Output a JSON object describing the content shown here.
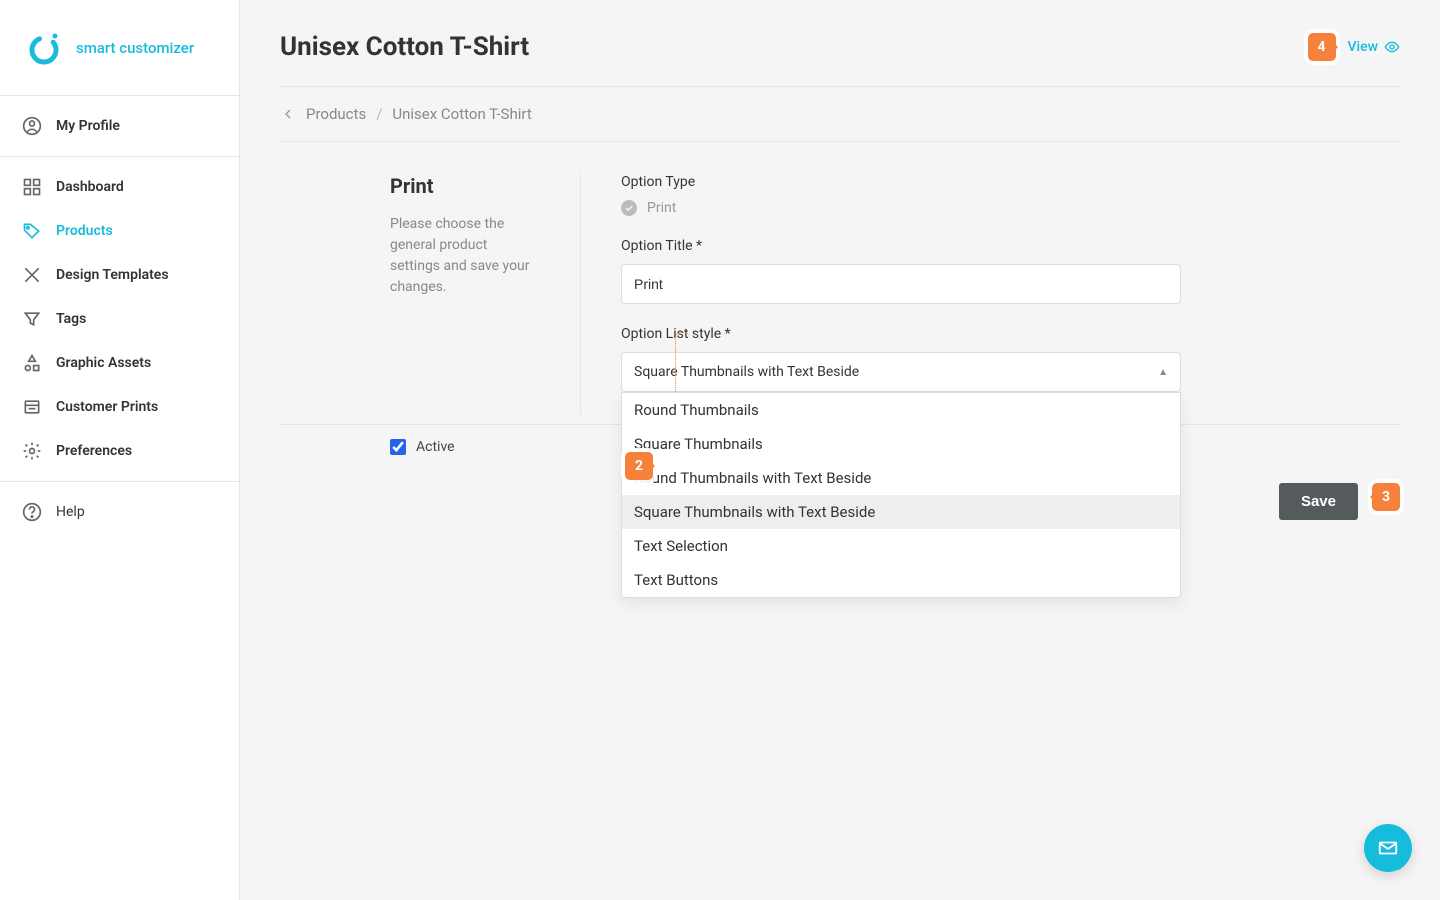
{
  "brand": {
    "name": "smart customizer"
  },
  "sidebar": {
    "profile_label": "My Profile",
    "items": [
      {
        "label": "Dashboard"
      },
      {
        "label": "Products"
      },
      {
        "label": "Design Templates"
      },
      {
        "label": "Tags"
      },
      {
        "label": "Graphic Assets"
      },
      {
        "label": "Customer Prints"
      },
      {
        "label": "Preferences"
      }
    ],
    "help_label": "Help"
  },
  "header": {
    "title": "Unisex Cotton T-Shirt",
    "view_label": "View"
  },
  "breadcrumb": {
    "root": "Products",
    "current": "Unisex Cotton T-Shirt"
  },
  "panel": {
    "heading": "Print",
    "description": "Please choose the general product settings and save your changes."
  },
  "form": {
    "option_type_label": "Option Type",
    "option_type_value": "Print",
    "option_title_label": "Option Title *",
    "option_title_value": "Print",
    "list_style_label": "Option List style *",
    "list_style_value": "Square Thumbnails with Text Beside",
    "list_style_options": [
      "Round Thumbnails",
      "Square Thumbnails",
      "Round Thumbnails with Text Beside",
      "Square Thumbnails with Text Beside",
      "Text Selection",
      "Text Buttons"
    ],
    "active_label": "Active",
    "active_checked": true,
    "save_label": "Save"
  },
  "markers": {
    "m2": "2",
    "m3": "3",
    "m4": "4"
  }
}
